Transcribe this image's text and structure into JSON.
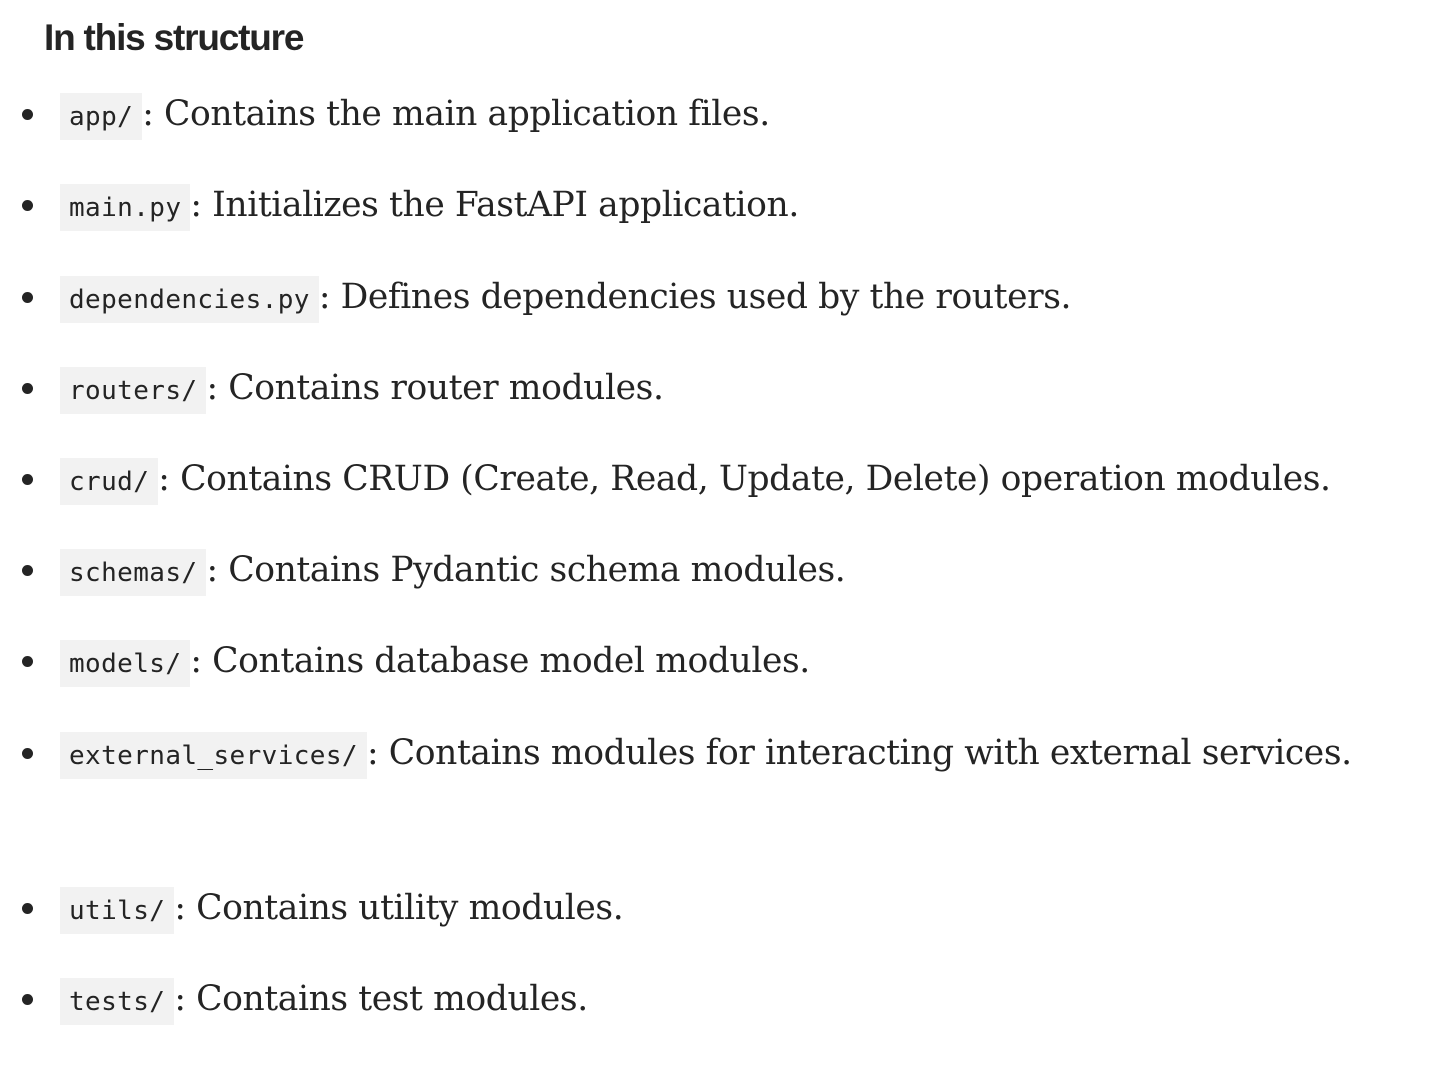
{
  "section": {
    "heading": "In this structure"
  },
  "items": [
    {
      "code": "app/",
      "text": ": Contains the main application files."
    },
    {
      "code": "main.py",
      "text": ": Initializes the FastAPI application."
    },
    {
      "code": "dependencies.py",
      "text": ": Defines dependencies used by the routers."
    },
    {
      "code": "routers/",
      "text": ": Contains router modules."
    },
    {
      "code": "crud/",
      "text": ": Contains CRUD (Create, Read, Update, Delete) operation modules."
    },
    {
      "code": "schemas/",
      "text": ": Contains Pydantic schema modules."
    },
    {
      "code": "models/",
      "text": ": Contains database model modules."
    },
    {
      "code": "external_services/",
      "text": ": Contains modules for interacting with external services."
    },
    {
      "code": "utils/",
      "text": ": Contains utility modules."
    },
    {
      "code": "tests/",
      "text": ": Contains test modules."
    }
  ]
}
